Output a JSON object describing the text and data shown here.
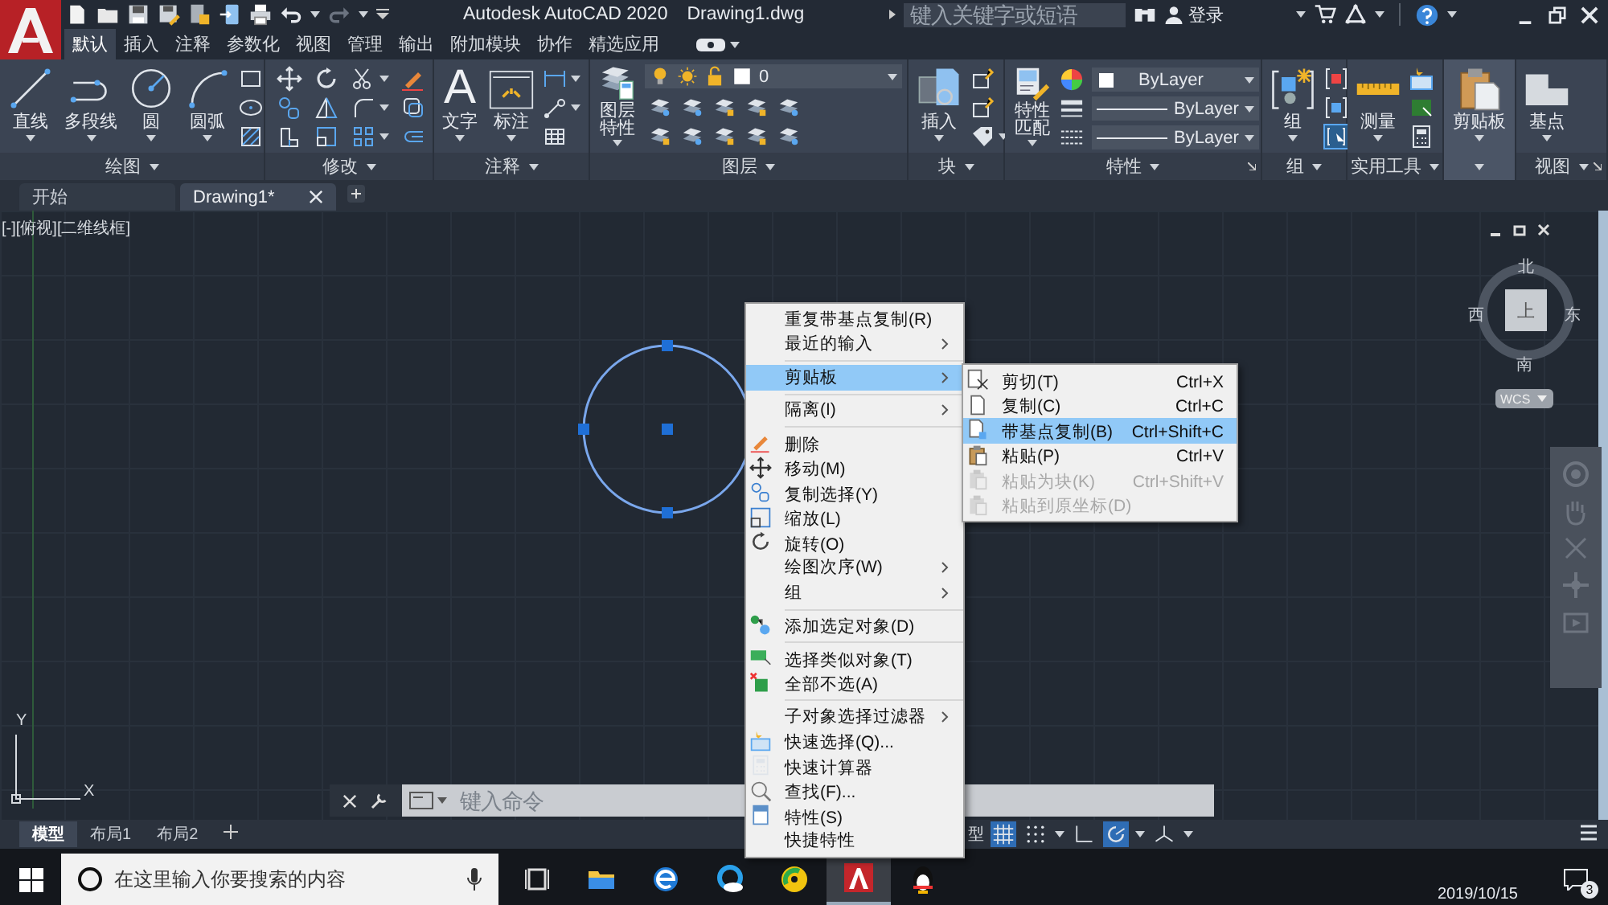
{
  "title_bar": {
    "app_name": "Autodesk AutoCAD 2020",
    "file_name": "Drawing1.dwg",
    "search_placeholder": "键入关键字或短语",
    "sign_in": "登录"
  },
  "ribbon_tabs": [
    {
      "label": "默认",
      "selected": true
    },
    {
      "label": "插入",
      "selected": false
    },
    {
      "label": "注释",
      "selected": false
    },
    {
      "label": "参数化",
      "selected": false
    },
    {
      "label": "视图",
      "selected": false
    },
    {
      "label": "管理",
      "selected": false
    },
    {
      "label": "输出",
      "selected": false
    },
    {
      "label": "附加模块",
      "selected": false
    },
    {
      "label": "协作",
      "selected": false
    },
    {
      "label": "精选应用",
      "selected": false
    }
  ],
  "panels": [
    {
      "title": "绘图",
      "collapsed": false,
      "tools": [
        {
          "label": "直线"
        },
        {
          "label": "多段线"
        },
        {
          "label": "圆"
        },
        {
          "label": "圆弧"
        }
      ]
    },
    {
      "title": "修改",
      "collapsed": false
    },
    {
      "title": "注释",
      "collapsed": false,
      "tools": [
        {
          "label": "文字",
          "glyph": "A"
        },
        {
          "label": "标注"
        }
      ]
    },
    {
      "title": "图层",
      "collapsed": false,
      "tools": [
        {
          "label": "图层特性"
        }
      ],
      "layer": "0"
    },
    {
      "title": "块",
      "collapsed": false,
      "tools": [
        {
          "label": "插入"
        }
      ]
    },
    {
      "title": "特性",
      "collapsed": false,
      "tools": [
        {
          "label": "特性匹配"
        }
      ],
      "properties": [
        "ByLayer",
        "ByLayer",
        "ByLayer"
      ]
    },
    {
      "title": "组",
      "collapsed": false,
      "tools": [
        {
          "label": "组"
        }
      ]
    },
    {
      "title": "实用工具",
      "collapsed": false,
      "tools": [
        {
          "label": "测量"
        }
      ]
    },
    {
      "collapsed": true,
      "tools": [
        {
          "label": "剪贴板"
        }
      ]
    },
    {
      "title": "视图",
      "collapsed": false,
      "tools": [
        {
          "label": "基点"
        }
      ]
    }
  ],
  "doc_tabs": [
    {
      "label": "开始",
      "selected": false,
      "closable": false
    },
    {
      "label": "Drawing1*",
      "selected": true,
      "closable": true
    }
  ],
  "viewport": {
    "label": "[-][俯视][二维线框]",
    "north": "北",
    "south": "南",
    "east": "东",
    "west": "西",
    "face": "上",
    "ucs": "WCS",
    "axis_x": "X",
    "axis_y": "Y"
  },
  "command_line": {
    "placeholder": "键入命令"
  },
  "context_menu": [
    {
      "kind": "item",
      "label": "重复带基点复制(R)",
      "submenu": false,
      "selected": false
    },
    {
      "kind": "item",
      "label": "最近的输入",
      "submenu": true,
      "selected": false
    },
    {
      "kind": "separator"
    },
    {
      "kind": "item",
      "label": "剪贴板",
      "submenu": true,
      "selected": true
    },
    {
      "kind": "separator"
    },
    {
      "kind": "item",
      "label": "隔离(I)",
      "submenu": true,
      "selected": false
    },
    {
      "kind": "separator"
    },
    {
      "kind": "item",
      "label": "删除",
      "submenu": false,
      "selected": false
    },
    {
      "kind": "item",
      "label": "移动(M)",
      "submenu": false,
      "selected": false
    },
    {
      "kind": "item",
      "label": "复制选择(Y)",
      "submenu": false,
      "selected": false
    },
    {
      "kind": "item",
      "label": "缩放(L)",
      "submenu": false,
      "selected": false
    },
    {
      "kind": "item",
      "label": "旋转(O)",
      "submenu": false,
      "selected": false
    },
    {
      "kind": "item",
      "label": "绘图次序(W)",
      "submenu": true,
      "selected": false
    },
    {
      "kind": "item",
      "label": "组",
      "submenu": true,
      "selected": false
    },
    {
      "kind": "separator"
    },
    {
      "kind": "item",
      "label": "添加选定对象(D)",
      "submenu": false,
      "selected": false
    },
    {
      "kind": "separator"
    },
    {
      "kind": "item",
      "label": "选择类似对象(T)",
      "submenu": false,
      "selected": false
    },
    {
      "kind": "item",
      "label": "全部不选(A)",
      "submenu": false,
      "selected": false
    },
    {
      "kind": "separator"
    },
    {
      "kind": "item",
      "label": "子对象选择过滤器",
      "submenu": true,
      "selected": false
    },
    {
      "kind": "item",
      "label": "快速选择(Q)...",
      "submenu": false,
      "selected": false
    },
    {
      "kind": "item",
      "label": "快速计算器",
      "submenu": false,
      "selected": false
    },
    {
      "kind": "item",
      "label": "查找(F)...",
      "submenu": false,
      "selected": false
    },
    {
      "kind": "item",
      "label": "特性(S)",
      "submenu": false,
      "selected": false
    },
    {
      "kind": "item",
      "label": "快捷特性",
      "submenu": false,
      "selected": false
    }
  ],
  "clipboard_submenu": [
    {
      "label": "剪切(T)",
      "shortcut": "Ctrl+X",
      "selected": false,
      "disabled": false
    },
    {
      "label": "复制(C)",
      "shortcut": "Ctrl+C",
      "selected": false,
      "disabled": false
    },
    {
      "label": "带基点复制(B)",
      "shortcut": "Ctrl+Shift+C",
      "selected": true,
      "disabled": false
    },
    {
      "label": "粘贴(P)",
      "shortcut": "Ctrl+V",
      "selected": false,
      "disabled": false
    },
    {
      "label": "粘贴为块(K)",
      "shortcut": "Ctrl+Shift+V",
      "selected": false,
      "disabled": true
    },
    {
      "label": "粘贴到原坐标(D)",
      "selected": false,
      "disabled": true
    }
  ],
  "layout_tabs": [
    {
      "label": "模型",
      "selected": true
    },
    {
      "label": "布局1",
      "selected": false
    },
    {
      "label": "布局2",
      "selected": false
    }
  ],
  "status_bar": {
    "space": "型",
    "toggles": [
      {
        "kind": "grid",
        "on": true
      },
      {
        "kind": "snap",
        "on": false
      },
      {
        "kind": "ortho",
        "on": false
      },
      {
        "kind": "polar",
        "on": true
      },
      {
        "kind": "isodraft",
        "on": false
      }
    ]
  },
  "taskbar": {
    "search_placeholder": "在这里输入你要搜索的内容",
    "date": "2019/10/15",
    "notifications": "3",
    "apps": [
      {
        "kind": "taskview",
        "active": false
      },
      {
        "kind": "folder",
        "active": false
      },
      {
        "kind": "browser",
        "active": false
      },
      {
        "kind": "cloud",
        "active": false
      },
      {
        "kind": "music",
        "active": false
      },
      {
        "kind": "cad",
        "active": true
      },
      {
        "kind": "penguin",
        "active": false
      }
    ]
  }
}
